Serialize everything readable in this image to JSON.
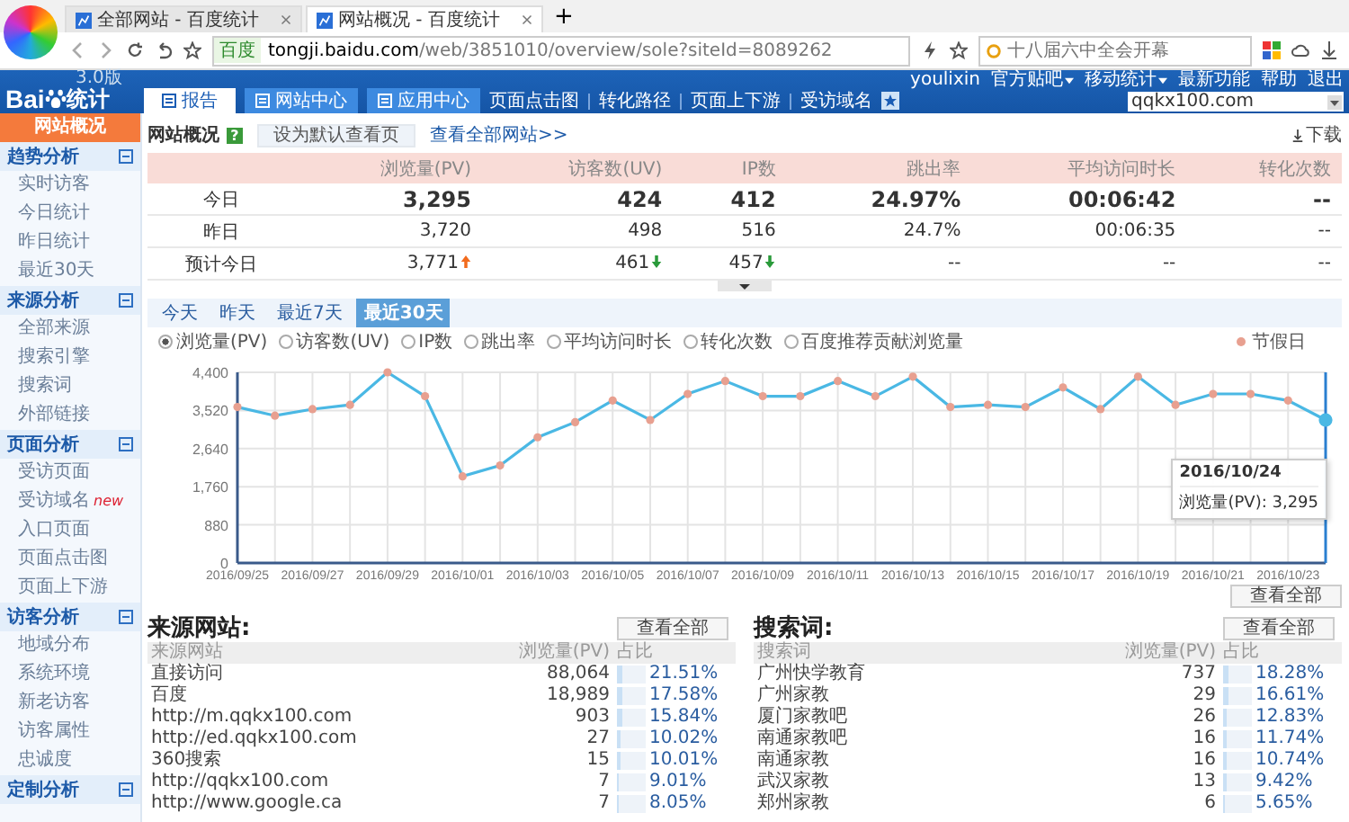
{
  "browser": {
    "tabs": [
      {
        "title": "全部网站 - 百度统计",
        "selected": false
      },
      {
        "title": "网站概况 - 百度统计",
        "selected": true
      }
    ],
    "new_tab": "+",
    "address": {
      "badge": "百度",
      "url_host": "tongji.baidu.com",
      "url_path": "/web/3851010/overview/sole?siteId=8089262"
    },
    "search": {
      "placeholder": "十八届六中全会开幕"
    }
  },
  "header": {
    "logo": {
      "text_a": "Bai",
      "text_b": "统计",
      "version": "3.0版"
    },
    "nav_tabs": [
      {
        "label": "报告",
        "selected": true
      },
      {
        "label": "网站中心",
        "selected": false
      },
      {
        "label": "应用中心",
        "selected": false
      }
    ],
    "nav_links": [
      "页面点击图",
      "转化路径",
      "页面上下游",
      "受访域名"
    ],
    "user_links": [
      {
        "label": "youlixin",
        "dropdown": false
      },
      {
        "label": "官方贴吧",
        "dropdown": true
      },
      {
        "label": "移动统计",
        "dropdown": true
      },
      {
        "label": "最新功能",
        "dropdown": false
      },
      {
        "label": "帮助",
        "dropdown": false
      },
      {
        "label": "退出",
        "dropdown": false
      }
    ],
    "site_select": "qqkx100.com"
  },
  "sidebar": {
    "top": {
      "label": "网站概况",
      "selected": true
    },
    "groups": [
      {
        "label": "趋势分析",
        "expanded": true,
        "items": [
          {
            "label": "实时访客",
            "selected": false
          },
          {
            "label": "今日统计",
            "selected": false
          },
          {
            "label": "昨日统计",
            "selected": false
          },
          {
            "label": "最近30天",
            "selected": false
          }
        ]
      },
      {
        "label": "来源分析",
        "expanded": true,
        "items": [
          {
            "label": "全部来源",
            "selected": false
          },
          {
            "label": "搜索引擎",
            "selected": false
          },
          {
            "label": "搜索词",
            "selected": false
          },
          {
            "label": "外部链接",
            "selected": false
          }
        ]
      },
      {
        "label": "页面分析",
        "expanded": true,
        "items": [
          {
            "label": "受访页面",
            "selected": false
          },
          {
            "label": "受访域名",
            "selected": false,
            "badge": "new"
          },
          {
            "label": "入口页面",
            "selected": false
          },
          {
            "label": "页面点击图",
            "selected": false
          },
          {
            "label": "页面上下游",
            "selected": false
          }
        ]
      },
      {
        "label": "访客分析",
        "expanded": true,
        "items": [
          {
            "label": "地域分布",
            "selected": false
          },
          {
            "label": "系统环境",
            "selected": false
          },
          {
            "label": "新老访客",
            "selected": false
          },
          {
            "label": "访客属性",
            "selected": false
          },
          {
            "label": "忠诚度",
            "selected": false
          }
        ]
      },
      {
        "label": "定制分析",
        "expanded": true
      }
    ]
  },
  "overview": {
    "title": "网站概况",
    "help": "?",
    "default_button": "设为默认查看页",
    "all_sites_link": "查看全部网站>>",
    "download": "下载",
    "columns": [
      "浏览量(PV)",
      "访客数(UV)",
      "IP数",
      "跳出率",
      "平均访问时长",
      "转化次数"
    ],
    "rows": [
      {
        "label": "今日",
        "bold": true,
        "cells": [
          {
            "text": "3,295"
          },
          {
            "text": "424"
          },
          {
            "text": "412"
          },
          {
            "text": "24.97%"
          },
          {
            "text": "00:06:42"
          },
          {
            "text": "--"
          }
        ]
      },
      {
        "label": "昨日",
        "bold": false,
        "cells": [
          {
            "text": "3,720"
          },
          {
            "text": "498"
          },
          {
            "text": "516"
          },
          {
            "text": "24.7%"
          },
          {
            "text": "00:06:35"
          },
          {
            "text": "--"
          }
        ]
      },
      {
        "label": "预计今日",
        "bold": false,
        "cells": [
          {
            "text": "3,771",
            "rising": true
          },
          {
            "text": "461",
            "rising": false
          },
          {
            "text": "457",
            "rising": false
          },
          {
            "text": "--"
          },
          {
            "text": "--"
          },
          {
            "text": "--"
          }
        ]
      }
    ]
  },
  "trend": {
    "periods": [
      {
        "label": "今天",
        "selected": false
      },
      {
        "label": "昨天",
        "selected": false
      },
      {
        "label": "最近7天",
        "selected": false
      },
      {
        "label": "最近30天",
        "selected": true
      }
    ],
    "metrics": [
      {
        "label": "浏览量(PV)",
        "selected": true
      },
      {
        "label": "访客数(UV)",
        "selected": false
      },
      {
        "label": "IP数",
        "selected": false
      },
      {
        "label": "跳出率",
        "selected": false
      },
      {
        "label": "平均访问时长",
        "selected": false
      },
      {
        "label": "转化次数",
        "selected": false
      },
      {
        "label": "百度推荐贡献浏览量",
        "selected": false
      }
    ],
    "legend": "节假日",
    "tooltip": {
      "title": "2016/10/24",
      "text": "浏览量(PV): 3,295"
    },
    "view_all": "查看全部",
    "chart_data": {
      "type": "line",
      "categories": [
        "2016/09/25",
        null,
        "2016/09/27",
        null,
        "2016/09/29",
        null,
        "2016/10/01",
        null,
        "2016/10/03",
        null,
        "2016/10/05",
        null,
        "2016/10/07",
        null,
        "2016/10/09",
        null,
        "2016/10/11",
        null,
        "2016/10/13",
        null,
        "2016/10/15",
        null,
        "2016/10/17",
        null,
        "2016/10/19",
        null,
        "2016/10/21",
        null,
        "2016/10/23",
        null
      ],
      "grid": true,
      "series": [
        {
          "color": "#4ab8e4",
          "marker": true,
          "values": [
            3600,
            3400,
            3550,
            3650,
            4400,
            3850,
            2000,
            2250,
            2900,
            3250,
            3750,
            3300,
            3900,
            4200,
            3850,
            3850,
            4200,
            3850,
            4300,
            3600,
            3650,
            3600,
            4050,
            3550,
            4300,
            3650,
            3900,
            3900,
            3750,
            3300
          ]
        }
      ],
      "ylim": [
        0,
        4400
      ],
      "yticks": [
        {
          "value": 0,
          "label": "0"
        },
        {
          "value": 880,
          "label": "880"
        },
        {
          "value": 1760,
          "label": "1,760"
        },
        {
          "value": 2640,
          "label": "2,640"
        },
        {
          "value": 3520,
          "label": "3,520"
        },
        {
          "value": 4400,
          "label": "4,400"
        }
      ]
    }
  },
  "tables": [
    {
      "title": "来源网站:",
      "view_all": "查看全部",
      "columns": [
        "来源网站",
        "浏览量(PV)",
        "占比"
      ],
      "rows": [
        {
          "name": "直接访问",
          "pv": "88,064",
          "share": "21.51%",
          "level": 0.2151
        },
        {
          "name": "百度",
          "pv": "18,989",
          "share": "17.58%",
          "level": 0.1758
        },
        {
          "name": "http://m.qqkx100.com",
          "pv": "903",
          "share": "15.84%",
          "level": 0.1584
        },
        {
          "name": "http://ed.qqkx100.com",
          "pv": "27",
          "share": "10.02%",
          "level": 0.1002
        },
        {
          "name": "360搜索",
          "pv": "15",
          "share": "10.01%",
          "level": 0.1001
        },
        {
          "name": "http://qqkx100.com",
          "pv": "7",
          "share": "9.01%",
          "level": 0.0901
        },
        {
          "name": "http://www.google.ca",
          "pv": "7",
          "share": "8.05%",
          "level": 0.0805
        }
      ]
    },
    {
      "title": "搜索词:",
      "view_all": "查看全部",
      "columns": [
        "搜索词",
        "浏览量(PV)",
        "占比"
      ],
      "rows": [
        {
          "name": "广州快学教育",
          "pv": "737",
          "share": "18.28%",
          "level": 0.1828
        },
        {
          "name": "广州家教",
          "pv": "29",
          "share": "16.61%",
          "level": 0.1661
        },
        {
          "name": "厦门家教吧",
          "pv": "26",
          "share": "12.83%",
          "level": 0.1283
        },
        {
          "name": "南通家教吧",
          "pv": "16",
          "share": "11.74%",
          "level": 0.1174
        },
        {
          "name": "南通家教",
          "pv": "16",
          "share": "10.74%",
          "level": 0.1074
        },
        {
          "name": "武汉家教",
          "pv": "13",
          "share": "9.42%",
          "level": 0.0942
        },
        {
          "name": "郑州家教",
          "pv": "6",
          "share": "5.65%",
          "level": 0.0565
        }
      ]
    }
  ]
}
